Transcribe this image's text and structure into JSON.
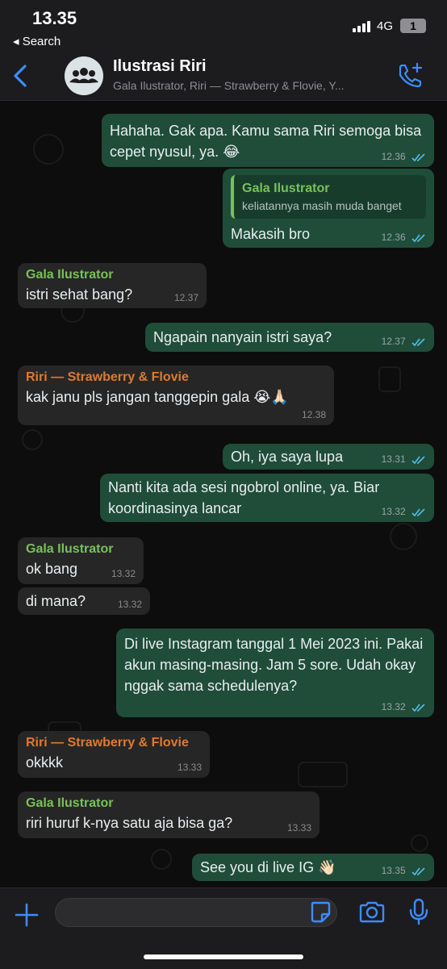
{
  "status_bar": {
    "time": "13.35",
    "back_label": "◂ Search",
    "network": "4G",
    "battery": "1"
  },
  "header": {
    "title": "Ilustrasi Riri",
    "subtitle": "Gala Ilustrator, Riri — Strawberry & Flovie, Y..."
  },
  "colors": {
    "outgoing_bubble": "#1f4d3a",
    "incoming_bubble": "#262626",
    "accent_green": "#78c257",
    "accent_orange": "#e07a2f",
    "link_blue": "#3d8cff"
  },
  "messages": [
    {
      "direction": "out",
      "text": "Hahaha. Gak apa. Kamu sama Riri semoga bisa cepet nyusul, ya. 😂",
      "time": "12.36",
      "read": true
    },
    {
      "direction": "out",
      "quote": {
        "name": "Gala Ilustrator",
        "text": "keliatannya masih muda banget"
      },
      "text": "Makasih bro",
      "time": "12.36",
      "read": true
    },
    {
      "direction": "in",
      "sender": "Gala Ilustrator",
      "text": "istri sehat bang?",
      "time": "12.37"
    },
    {
      "direction": "out",
      "text": "Ngapain nanyain istri saya?",
      "time": "12.37",
      "read": true
    },
    {
      "direction": "in",
      "sender": "Riri — Strawberry & Flovie",
      "text": "kak janu pls jangan tanggepin gala 😭🙏🏻",
      "time": "12.38"
    },
    {
      "direction": "out",
      "text": "Oh, iya saya lupa",
      "time": "13.31",
      "read": true
    },
    {
      "direction": "out",
      "text": "Nanti kita ada sesi ngobrol online, ya. Biar koordinasinya lancar",
      "time": "13.32",
      "read": true
    },
    {
      "direction": "in",
      "sender": "Gala Ilustrator",
      "text": "ok bang",
      "time": "13.32"
    },
    {
      "direction": "in",
      "text": "di mana?",
      "time": "13.32"
    },
    {
      "direction": "out",
      "text": "Di live Instagram tanggal 1 Mei 2023 ini. Pakai akun masing-masing. Jam 5 sore. Udah okay nggak sama schedulenya?",
      "time": "13.32",
      "read": true
    },
    {
      "direction": "in",
      "sender": "Riri — Strawberry & Flovie",
      "text": "okkkk",
      "time": "13.33"
    },
    {
      "direction": "in",
      "sender": "Gala Ilustrator",
      "text": "riri huruf k-nya satu aja bisa ga?",
      "time": "13.33"
    },
    {
      "direction": "out",
      "text": "See you di live IG 👋🏻",
      "time": "13.35",
      "read": true
    }
  ],
  "composer": {
    "placeholder": ""
  }
}
